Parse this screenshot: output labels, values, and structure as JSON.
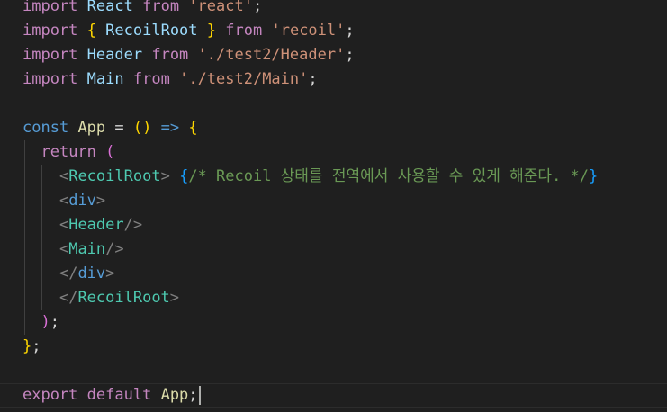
{
  "editor": {
    "language": "javascript-react",
    "theme_colors": {
      "background": "#1f1f1f",
      "keyword": "#c586c0",
      "declaration": "#569cd6",
      "variable": "#9cdcfe",
      "function": "#dcdcaa",
      "string": "#ce9178",
      "component_tag": "#4ec9b0",
      "comment": "#6a9955",
      "bracket_level1": "#ffd700",
      "bracket_level2": "#da70d6",
      "bracket_level3": "#179fff"
    },
    "lines": [
      {
        "tokens": [
          {
            "t": "import",
            "c": "kw"
          },
          {
            "t": " ",
            "c": "punc"
          },
          {
            "t": "React",
            "c": "var"
          },
          {
            "t": " ",
            "c": "punc"
          },
          {
            "t": "from",
            "c": "kw"
          },
          {
            "t": " ",
            "c": "punc"
          },
          {
            "t": "'react'",
            "c": "str"
          },
          {
            "t": ";",
            "c": "punc"
          }
        ]
      },
      {
        "tokens": [
          {
            "t": "import",
            "c": "kw"
          },
          {
            "t": " ",
            "c": "punc"
          },
          {
            "t": "{",
            "c": "b1"
          },
          {
            "t": " ",
            "c": "punc"
          },
          {
            "t": "RecoilRoot",
            "c": "var"
          },
          {
            "t": " ",
            "c": "punc"
          },
          {
            "t": "}",
            "c": "b1"
          },
          {
            "t": " ",
            "c": "punc"
          },
          {
            "t": "from",
            "c": "kw"
          },
          {
            "t": " ",
            "c": "punc"
          },
          {
            "t": "'recoil'",
            "c": "str"
          },
          {
            "t": ";",
            "c": "punc"
          }
        ]
      },
      {
        "tokens": [
          {
            "t": "import",
            "c": "kw"
          },
          {
            "t": " ",
            "c": "punc"
          },
          {
            "t": "Header",
            "c": "var"
          },
          {
            "t": " ",
            "c": "punc"
          },
          {
            "t": "from",
            "c": "kw"
          },
          {
            "t": " ",
            "c": "punc"
          },
          {
            "t": "'./test2/Header'",
            "c": "str"
          },
          {
            "t": ";",
            "c": "punc"
          }
        ]
      },
      {
        "tokens": [
          {
            "t": "import",
            "c": "kw"
          },
          {
            "t": " ",
            "c": "punc"
          },
          {
            "t": "Main",
            "c": "var"
          },
          {
            "t": " ",
            "c": "punc"
          },
          {
            "t": "from",
            "c": "kw"
          },
          {
            "t": " ",
            "c": "punc"
          },
          {
            "t": "'./test2/Main'",
            "c": "str"
          },
          {
            "t": ";",
            "c": "punc"
          }
        ]
      },
      {
        "tokens": []
      },
      {
        "tokens": [
          {
            "t": "const",
            "c": "decl"
          },
          {
            "t": " ",
            "c": "punc"
          },
          {
            "t": "App",
            "c": "fn"
          },
          {
            "t": " = ",
            "c": "op"
          },
          {
            "t": "()",
            "c": "b1"
          },
          {
            "t": " ",
            "c": "punc"
          },
          {
            "t": "=>",
            "c": "decl"
          },
          {
            "t": " ",
            "c": "punc"
          },
          {
            "t": "{",
            "c": "b1"
          }
        ]
      },
      {
        "tokens": [
          {
            "t": "  ",
            "c": "punc"
          },
          {
            "t": "return",
            "c": "kw"
          },
          {
            "t": " ",
            "c": "punc"
          },
          {
            "t": "(",
            "c": "b2"
          }
        ]
      },
      {
        "tokens": [
          {
            "t": "    ",
            "c": "punc"
          },
          {
            "t": "<",
            "c": "ang"
          },
          {
            "t": "RecoilRoot",
            "c": "tag"
          },
          {
            "t": ">",
            "c": "ang"
          },
          {
            "t": " ",
            "c": "punc"
          },
          {
            "t": "{",
            "c": "b3"
          },
          {
            "t": "/* Recoil 상태를 전역에서 사용할 수 있게 해준다. */",
            "c": "com"
          },
          {
            "t": "}",
            "c": "b3"
          }
        ]
      },
      {
        "tokens": [
          {
            "t": "    ",
            "c": "punc"
          },
          {
            "t": "<",
            "c": "ang"
          },
          {
            "t": "div",
            "c": "decl"
          },
          {
            "t": ">",
            "c": "ang"
          }
        ]
      },
      {
        "tokens": [
          {
            "t": "    ",
            "c": "punc"
          },
          {
            "t": "<",
            "c": "ang"
          },
          {
            "t": "Header",
            "c": "tag"
          },
          {
            "t": "/>",
            "c": "ang"
          }
        ]
      },
      {
        "tokens": [
          {
            "t": "    ",
            "c": "punc"
          },
          {
            "t": "<",
            "c": "ang"
          },
          {
            "t": "Main",
            "c": "tag"
          },
          {
            "t": "/>",
            "c": "ang"
          }
        ]
      },
      {
        "tokens": [
          {
            "t": "    ",
            "c": "punc"
          },
          {
            "t": "</",
            "c": "ang"
          },
          {
            "t": "div",
            "c": "decl"
          },
          {
            "t": ">",
            "c": "ang"
          }
        ]
      },
      {
        "tokens": [
          {
            "t": "    ",
            "c": "punc"
          },
          {
            "t": "</",
            "c": "ang"
          },
          {
            "t": "RecoilRoot",
            "c": "tag"
          },
          {
            "t": ">",
            "c": "ang"
          }
        ]
      },
      {
        "tokens": [
          {
            "t": "  ",
            "c": "punc"
          },
          {
            "t": ")",
            "c": "b2"
          },
          {
            "t": ";",
            "c": "punc"
          }
        ]
      },
      {
        "tokens": [
          {
            "t": "}",
            "c": "b1"
          },
          {
            "t": ";",
            "c": "punc"
          }
        ]
      },
      {
        "tokens": []
      },
      {
        "tokens": [
          {
            "t": "export",
            "c": "kw"
          },
          {
            "t": " ",
            "c": "punc"
          },
          {
            "t": "default",
            "c": "kw"
          },
          {
            "t": " ",
            "c": "punc"
          },
          {
            "t": "App",
            "c": "fn"
          },
          {
            "t": ";",
            "c": "punc"
          }
        ],
        "cursor": true
      }
    ]
  }
}
